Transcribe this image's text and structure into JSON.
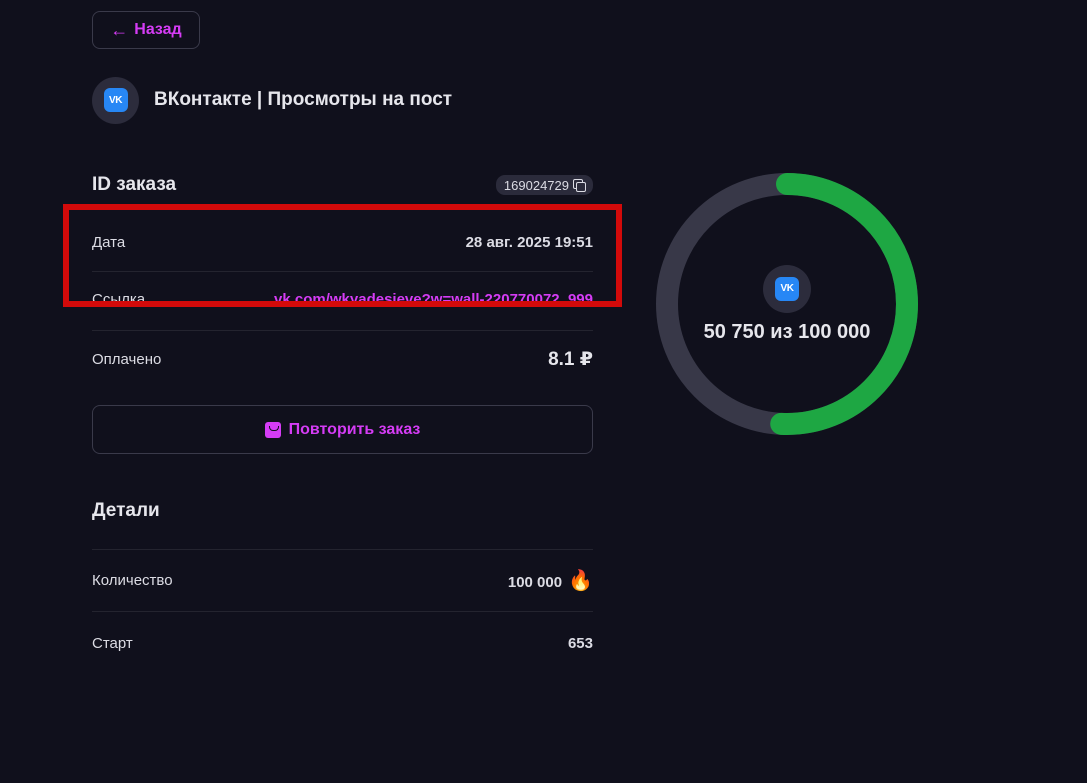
{
  "nav": {
    "back_label": "Назад"
  },
  "service": {
    "title": "ВКонтакте | Просмотры на пост",
    "icon": "vk-logo-icon",
    "icon_text": "VK"
  },
  "order": {
    "id_label": "ID заказа",
    "id_value": "169024729",
    "date_label": "Дата",
    "date_value": "28 авг. 2025 19:51",
    "link_label": "Ссылка",
    "link_value": "vk.com/wkyadesieve?w=wall-220770072_999",
    "paid_label": "Оплачено",
    "paid_value": "8.1 ₽",
    "repeat_label": "Повторить заказ"
  },
  "details": {
    "title": "Детали",
    "quantity_label": "Количество",
    "quantity_value": "100 000",
    "start_label": "Старт",
    "start_value": "653"
  },
  "progress": {
    "done": 50750,
    "total": 100000,
    "text": "50 750 из 100 000",
    "fraction": 0.5075
  },
  "colors": {
    "accent": "#d53cf5",
    "progress": "#1ea743",
    "track": "#383848",
    "highlight": "#d30a0a",
    "vk": "#2787f5"
  }
}
